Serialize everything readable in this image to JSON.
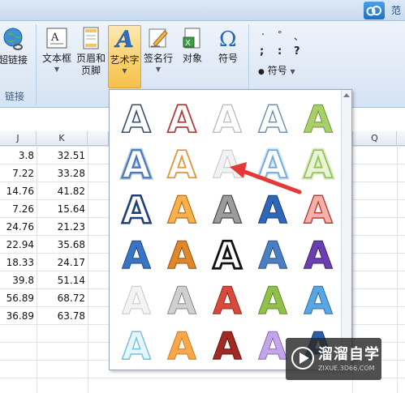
{
  "top_strip": {
    "right_text": "范"
  },
  "ribbon": {
    "hyperlink": {
      "label": "超链接"
    },
    "textbox": {
      "label": "文本框"
    },
    "header_footer": {
      "label_line1": "页眉和",
      "label_line2": "页脚"
    },
    "wordart": {
      "label": "艺术字"
    },
    "signature": {
      "label": "签名行"
    },
    "object": {
      "label": "对象"
    },
    "symbol": {
      "label": "符号"
    },
    "symbol_glyphs": {
      "row1a": "·",
      "row1b": "°",
      "row1c": "、",
      "row2a": ";",
      "row2b": ":",
      "row2c": "?"
    },
    "symbol_menu": {
      "glyph": "●",
      "label": "符号"
    },
    "group_links": "链接"
  },
  "sheet": {
    "columns": [
      "J",
      "K",
      "Q"
    ],
    "rows": [
      {
        "j": "3.8",
        "k": "32.51"
      },
      {
        "j": "7.22",
        "k": "33.28"
      },
      {
        "j": "14.76",
        "k": "41.82"
      },
      {
        "j": "7.26",
        "k": "15.64"
      },
      {
        "j": "24.76",
        "k": "21.23"
      },
      {
        "j": "22.94",
        "k": "35.68"
      },
      {
        "j": "18.33",
        "k": "24.17"
      },
      {
        "j": "39.8",
        "k": "51.14"
      },
      {
        "j": "56.89",
        "k": "68.72"
      },
      {
        "j": "36.89",
        "k": "63.78"
      }
    ]
  },
  "gallery": {
    "glyph": "A",
    "styles": [
      [
        "outline-blue",
        "outline-red",
        "outline-gray",
        "outline-lightblue",
        "gradient-green"
      ],
      [
        "glow-blue",
        "outline-orange",
        "soft-gray",
        "glow-lightblue",
        "glow-green"
      ],
      [
        "bevel-darkblue",
        "bevel-orange",
        "bevel-gray",
        "bevel-blue",
        "bevel-red"
      ],
      [
        "solid-blue",
        "solid-orange",
        "solid-black",
        "reflect-blue",
        "solid-purple"
      ],
      [
        "plain-lightgray",
        "plain-gray",
        "solid-red",
        "solid-green",
        "solid-skyblue"
      ],
      [
        "light-cyan",
        "light-orange",
        "dark-red",
        "light-purple",
        "dark-blue"
      ]
    ]
  },
  "annotation": {
    "color": "#e53935"
  },
  "watermark": {
    "name": "溜溜自学",
    "url": "ZIXUE.3D66.COM"
  }
}
